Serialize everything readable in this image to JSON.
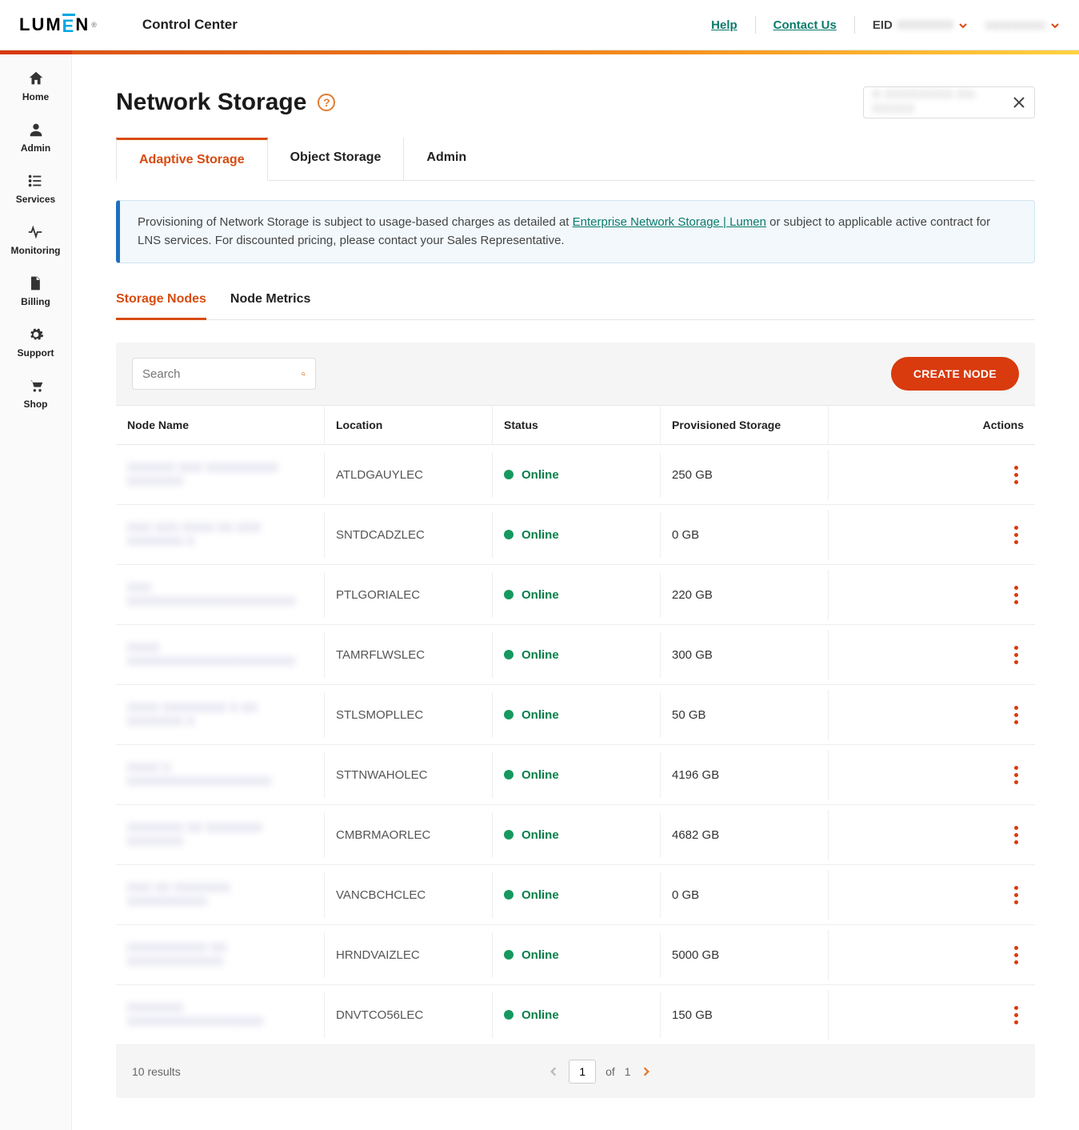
{
  "header": {
    "brand_pre": "LUM",
    "brand_accent": "E",
    "brand_post": "N",
    "app_title": "Control Center",
    "help_label": "Help",
    "contact_label": "Contact Us",
    "eid_prefix": "EID",
    "eid_value": "XXXXXXX",
    "account_value": "xxxxxxxxx"
  },
  "sidebar": {
    "items": [
      {
        "label": "Home",
        "icon": "home-icon"
      },
      {
        "label": "Admin",
        "icon": "user-icon"
      },
      {
        "label": "Services",
        "icon": "list-icon"
      },
      {
        "label": "Monitoring",
        "icon": "pulse-icon"
      },
      {
        "label": "Billing",
        "icon": "file-icon"
      },
      {
        "label": "Support",
        "icon": "gear-icon"
      },
      {
        "label": "Shop",
        "icon": "cart-icon"
      }
    ]
  },
  "page": {
    "title": "Network Storage",
    "context_value": "X-XXXXXXXX-XX-XXXXX"
  },
  "tabs_primary": [
    {
      "label": "Adaptive Storage",
      "active": true
    },
    {
      "label": "Object Storage",
      "active": false
    },
    {
      "label": "Admin",
      "active": false
    }
  ],
  "banner": {
    "text_before": "Provisioning of Network Storage is subject to usage-based charges as detailed at ",
    "link_text": "Enterprise Network Storage | Lumen",
    "text_after": " or subject to applicable active contract for LNS services. For discounted pricing, please contact your Sales Representative."
  },
  "tabs_secondary": [
    {
      "label": "Storage Nodes",
      "active": true
    },
    {
      "label": "Node Metrics",
      "active": false
    }
  ],
  "toolbar": {
    "search_placeholder": "Search",
    "create_label": "CREATE NODE"
  },
  "table": {
    "columns": {
      "name": "Node Name",
      "location": "Location",
      "status": "Status",
      "provisioned": "Provisioned Storage",
      "actions": "Actions"
    },
    "rows": [
      {
        "name": "XXXXXX XXX XXXXXXXXX XXXXXXX",
        "location": "ATLDGAUYLEC",
        "status": "Online",
        "provisioned": "250 GB"
      },
      {
        "name": "XXX XXX XXXX XX XXX XXXXXXX X",
        "location": "SNTDCADZLEC",
        "status": "Online",
        "provisioned": "0 GB"
      },
      {
        "name": "XXX XXXXXXXXXXXXXXXXXXXXX",
        "location": "PTLGORIALEC",
        "status": "Online",
        "provisioned": "220 GB"
      },
      {
        "name": "XXXX XXXXXXXXXXXXXXXXXXXXX",
        "location": "TAMRFLWSLEC",
        "status": "Online",
        "provisioned": "300 GB"
      },
      {
        "name": "XXXX XXXXXXXX X XX XXXXXXX X",
        "location": "STLSMOPLLEC",
        "status": "Online",
        "provisioned": "50 GB"
      },
      {
        "name": "XXXX X XXXXXXXXXXXXXXXXXX",
        "location": "STTNWAHOLEC",
        "status": "Online",
        "provisioned": "4196 GB"
      },
      {
        "name": "XXXXXXX XX XXXXXXX XXXXXXX",
        "location": "CMBRMAORLEC",
        "status": "Online",
        "provisioned": "4682 GB"
      },
      {
        "name": "XXX XX XXXXXXX XXXXXXXXXX",
        "location": "VANCBCHCLEC",
        "status": "Online",
        "provisioned": "0 GB"
      },
      {
        "name": "XXXXXXXXXX XX XXXXXXXXXXXX",
        "location": "HRNDVAIZLEC",
        "status": "Online",
        "provisioned": "5000 GB"
      },
      {
        "name": "XXXXXXX XXXXXXXXXXXXXXXXX",
        "location": "DNVTCO56LEC",
        "status": "Online",
        "provisioned": "150 GB"
      }
    ]
  },
  "footer": {
    "results_text": "10 results",
    "page_current": "1",
    "page_of_label": "of",
    "page_total": "1"
  }
}
